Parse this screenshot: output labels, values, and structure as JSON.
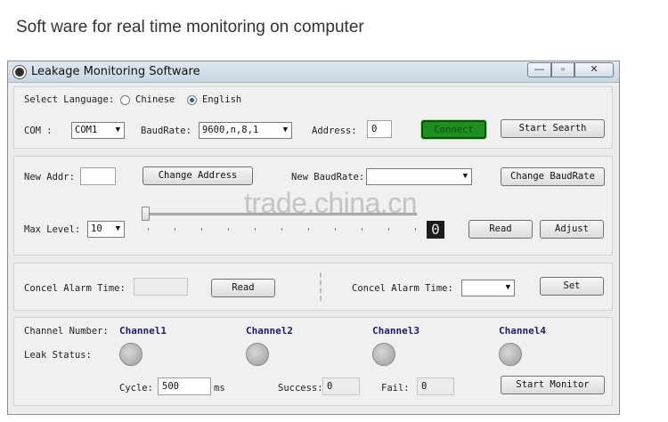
{
  "caption": "Soft ware for real time monitoring on computer",
  "window": {
    "title": "Leakage Monitoring Software",
    "min_glyph": "—",
    "max_glyph": "▫",
    "close_glyph": "✕"
  },
  "language": {
    "label": "Select Language:",
    "options": [
      "Chinese",
      "English"
    ],
    "selected": "English"
  },
  "connection": {
    "com_label": "COM :",
    "com_value": "COM1",
    "baud_label": "BaudRate:",
    "baud_value": "9600,n,8,1",
    "address_label": "Address:",
    "address_value": "0",
    "connect_label": "Connect",
    "search_label": "Start Searth"
  },
  "settings": {
    "new_addr_label": "New Addr:",
    "new_addr_value": "",
    "change_address_label": "Change Address",
    "new_baud_label": "New BaudRate:",
    "new_baud_value": "",
    "change_baud_label": "Change BaudRate",
    "max_level_label": "Max Level:",
    "max_level_value": "10",
    "slider_value": 0,
    "level_display": "0",
    "read_label": "Read",
    "adjust_label": "Adjust"
  },
  "alarm": {
    "left_label": "Concel Alarm Time:",
    "left_value": "",
    "read_label": "Read",
    "right_label": "Concel Alarm Time:",
    "right_value": "",
    "set_label": "Set"
  },
  "monitor": {
    "channel_number_label": "Channel Number:",
    "leak_status_label": "Leak Status:",
    "channels": [
      "Channel1",
      "Channel2",
      "Channel3",
      "Channel4"
    ],
    "cycle_label": "Cycle:",
    "cycle_value": "500",
    "cycle_unit": "ms",
    "success_label": "Success:",
    "success_value": "0",
    "fail_label": "Fail:",
    "fail_value": "0",
    "start_label": "Start Monitor"
  },
  "watermark": "trade.china.cn",
  "colors": {
    "connect_green": "#1e8f1e",
    "channel_text": "#1d1d6b",
    "led_idle": "#b0b0b0"
  }
}
